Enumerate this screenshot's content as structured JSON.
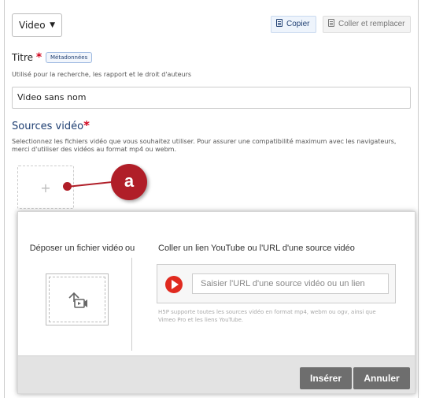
{
  "type_select": {
    "value": "Video"
  },
  "toolbar": {
    "copy_label": "Copier",
    "paste_replace_label": "Coller et remplacer"
  },
  "title_field": {
    "label": "Titre",
    "required_mark": "*",
    "metadata_tag": "Métadonnées",
    "description": "Utilisé pour la recherche, les rapport et le droit d'auteurs",
    "value": "Video sans nom"
  },
  "sources_field": {
    "label": "Sources vidéo",
    "required_mark": "*",
    "description": "Selectionnez les fichiers vidéo que vous souhaitez utiliser. Pour assurer une compatibilité maximum avec les navigateurs, merci d'utiliser des vidéos au format mp4 ou webm.",
    "add_symbol": "+"
  },
  "callout": {
    "label": "a",
    "color": "#b01e28"
  },
  "dialog": {
    "drop_title": "Déposer un fichier vidéo",
    "or_text": "ou",
    "paste_title": "Coller un lien YouTube ou l'URL d'une source vidéo",
    "url_placeholder": "Saisier l'URL d'une source vidéo ou un lien",
    "support_text": "H5P supporte toutes les sources vidéo en format mp4, webm ou ogv, ainsi que Vimeo Pro et les liens YouTube.",
    "insert_label": "Insérer",
    "cancel_label": "Annuler"
  },
  "icons": [
    "chevron-down-icon",
    "copy-icon",
    "paste-icon",
    "video-upload-icon",
    "youtube-play-icon",
    "plus-icon"
  ]
}
